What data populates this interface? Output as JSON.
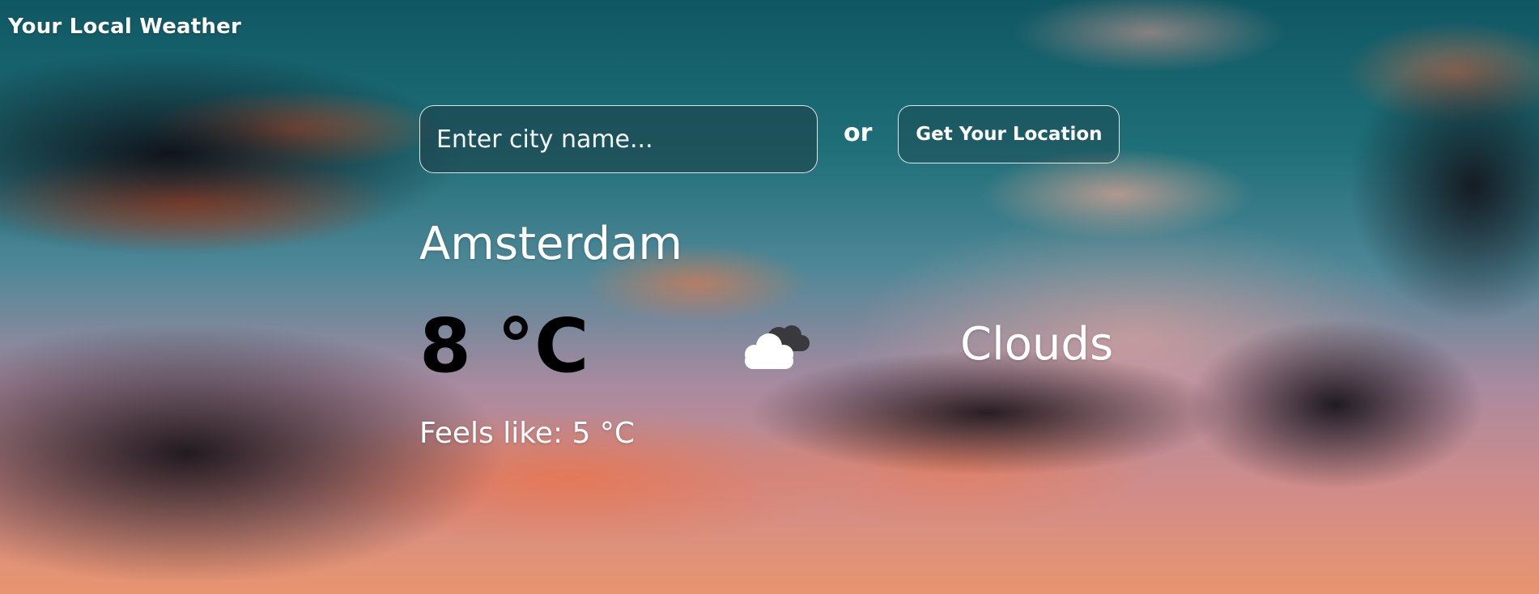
{
  "header": {
    "title": "Your Local Weather"
  },
  "search": {
    "placeholder": "Enter city name...",
    "value": "",
    "or_label": "or",
    "location_button_label": "Get Your Location"
  },
  "weather": {
    "city": "Amsterdam",
    "temperature": "8 °C",
    "condition": "Clouds",
    "feels_like": "Feels like: 5 °C",
    "icon": "cloud-icon"
  },
  "colors": {
    "text_primary": "#ffffff",
    "temperature_text": "#000000",
    "sky_top": "#0f5763",
    "sky_bottom": "#e8946f"
  }
}
